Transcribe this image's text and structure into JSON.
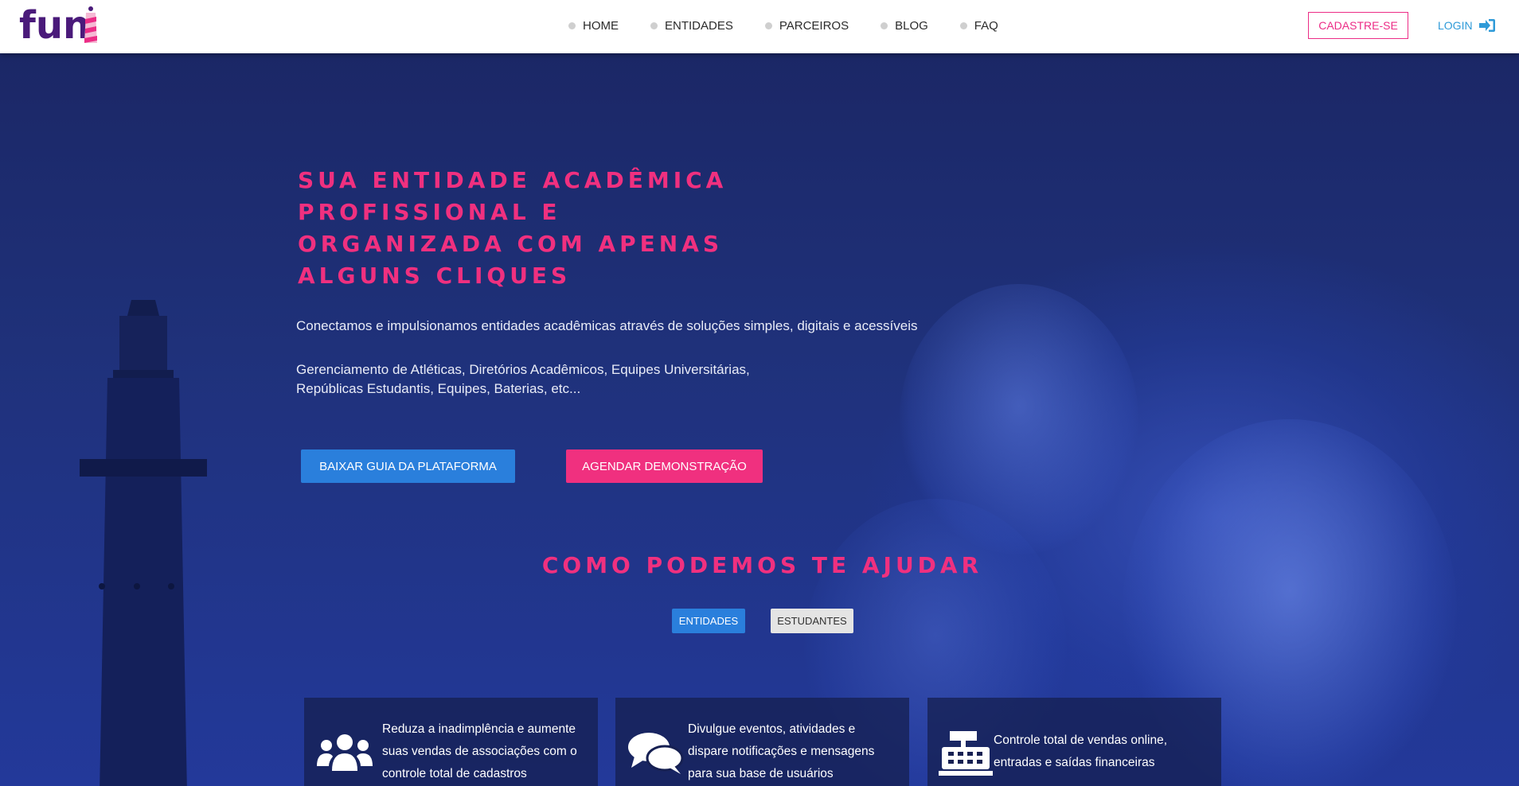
{
  "brand": {
    "logo_text": "fun"
  },
  "nav": {
    "items": [
      {
        "label": "HOME"
      },
      {
        "label": "ENTIDADES"
      },
      {
        "label": "PARCEIROS"
      },
      {
        "label": "BLOG"
      },
      {
        "label": "FAQ"
      }
    ],
    "signup_label": "CADASTRE-SE",
    "login_label": "LOGIN"
  },
  "hero": {
    "title": "SUA ENTIDADE ACADÊMICA PROFISSIONAL E ORGANIZADA COM APENAS ALGUNS CLIQUES",
    "subtitle": "Conectamos e impulsionamos entidades acadêmicas através de soluções simples, digitais e acessíveis",
    "description_line1": "Gerenciamento de Atléticas, Diretórios Acadêmicos, Equipes Universitárias,",
    "description_line2": "Repúblicas Estudantis, Equipes, Baterias, etc...",
    "guide_button": "BAIXAR GUIA DA PLATAFORMA",
    "demo_button": "AGENDAR DEMONSTRAÇÃO"
  },
  "help": {
    "title": "COMO PODEMOS TE AJUDAR",
    "tabs": [
      {
        "label": "ENTIDADES",
        "active": true
      },
      {
        "label": "ESTUDANTES",
        "active": false
      }
    ],
    "cards": [
      {
        "icon": "users-icon",
        "text": "Reduza a inadimplência e aumente suas vendas de associações com o controle total de cadastros"
      },
      {
        "icon": "chat-bubbles-icon",
        "text": "Divulgue eventos, atividades e dispare notificações e mensagens para sua base de usuários"
      },
      {
        "icon": "cash-register-icon",
        "text": "Controle total de vendas online, entradas e saídas financeiras"
      }
    ]
  },
  "colors": {
    "brand_purple": "#4a1a7a",
    "accent_pink": "#f0307f",
    "accent_blue": "#2a7fdc",
    "hero_bg": "#1f317a"
  }
}
